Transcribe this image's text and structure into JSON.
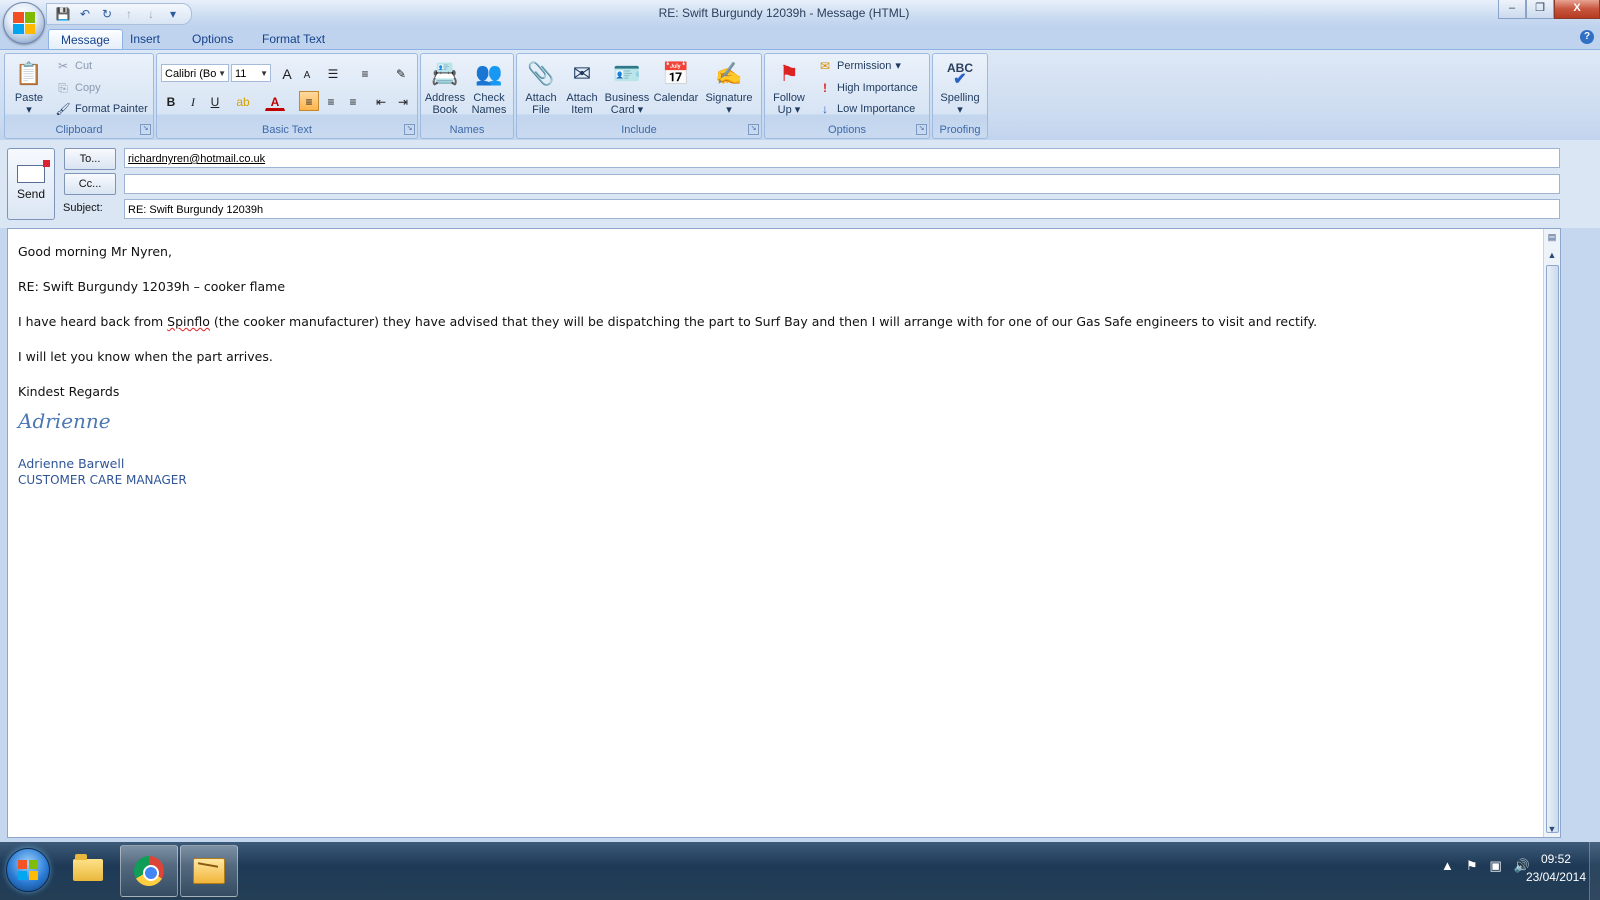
{
  "window": {
    "title": "RE: Swift Burgundy 12039h - Message (HTML)",
    "controls": {
      "minimize": "–",
      "restore": "❐",
      "close": "X"
    }
  },
  "quick_access": {
    "save": "💾",
    "undo": "↶",
    "redo": "↻",
    "prev": "↑",
    "next": "↓",
    "customize": "▾"
  },
  "tabs": [
    "Message",
    "Insert",
    "Options",
    "Format Text"
  ],
  "help": "?",
  "clipboard": {
    "paste": "Paste",
    "cut": "Cut",
    "copy": "Copy",
    "format_painter": "Format Painter",
    "label": "Clipboard"
  },
  "basic_text": {
    "font": "Calibri (Bo",
    "size": "11",
    "bold": "B",
    "italic": "I",
    "underline": "U",
    "font_color": "A",
    "grow": "A",
    "shrink": "A",
    "label": "Basic Text"
  },
  "names": {
    "address_book": [
      "Address",
      "Book"
    ],
    "check_names": [
      "Check",
      "Names"
    ],
    "label": "Names"
  },
  "include": {
    "attach_file": [
      "Attach",
      "File"
    ],
    "attach_item": [
      "Attach",
      "Item"
    ],
    "business_card": [
      "Business",
      "Card"
    ],
    "calendar": "Calendar",
    "signature": "Signature",
    "label": "Include"
  },
  "options": {
    "follow_up": [
      "Follow",
      "Up"
    ],
    "permission": "Permission",
    "high_importance": "High Importance",
    "low_importance": "Low Importance",
    "label": "Options"
  },
  "proofing": {
    "icon_text": "ABC",
    "spelling": "Spelling",
    "label": "Proofing"
  },
  "header": {
    "send": "Send",
    "to_button": "To...",
    "cc_button": "Cc...",
    "subject_label": "Subject:",
    "to_value": "richardnyren@hotmail.co.uk",
    "cc_value": "",
    "subject_value": "RE: Swift Burgundy 12039h"
  },
  "body": {
    "greeting": "Good morning Mr Nyren,",
    "re_line": "RE: Swift Burgundy 12039h – cooker flame",
    "para1_before": "I have heard back from ",
    "para1_misspelled": "Spinflo",
    "para1_after": " (the cooker manufacturer) they have advised that  they will be dispatching the part to Surf Bay and then I will arrange with for one of our Gas Safe engineers to visit and rectify.",
    "para2": "I will let you know when the part arrives.",
    "closing": "Kindest Regards",
    "signature_script": "Adrienne",
    "signature_name": "Adrienne Barwell",
    "signature_title": "CUSTOMER CARE MANAGER"
  },
  "taskbar": {
    "time": "09:52",
    "date": "23/04/2014",
    "tray": [
      "▲",
      "⚑",
      "▣",
      "🔊"
    ]
  }
}
